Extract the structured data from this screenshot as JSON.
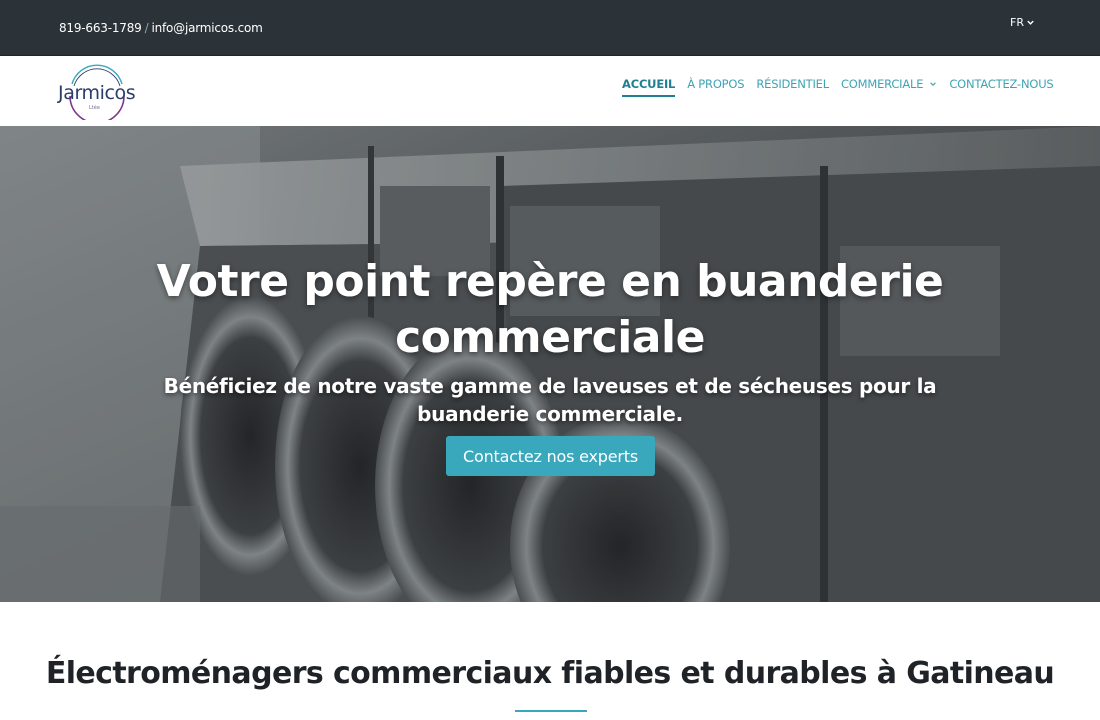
{
  "topbar": {
    "phone": "819-663-1789",
    "separator": "/",
    "email": "info@jarmicos.com",
    "language": "FR"
  },
  "logo": {
    "name": "Jarmicos",
    "subtitle": "Ltée"
  },
  "nav": {
    "items": [
      {
        "label": "ACCUEIL",
        "active": true
      },
      {
        "label": "À PROPOS"
      },
      {
        "label": "RÉSIDENTIEL"
      },
      {
        "label": "COMMERCIALE",
        "has_dropdown": true
      },
      {
        "label": "CONTACTEZ-NOUS"
      }
    ]
  },
  "hero": {
    "title": "Votre point repère en buanderie commerciale",
    "subtitle": "Bénéficiez de notre vaste gamme de laveuses et de sécheuses pour la buanderie commerciale.",
    "cta_label": "Contactez nos experts"
  },
  "section": {
    "title": "Électroménagers commerciaux fiables et durables à Gatineau"
  },
  "colors": {
    "topbar_bg": "#2b3338",
    "accent": "#3aa8bc",
    "nav_active": "#1f7f93",
    "logo_text": "#2a3d6b"
  }
}
